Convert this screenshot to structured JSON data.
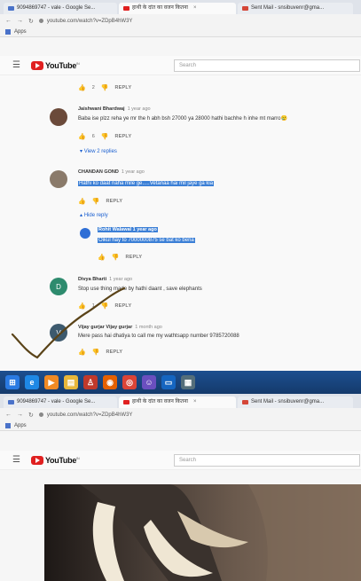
{
  "browser_top": {
    "tabs": [
      {
        "label": "9094869747 - vale - Google Se...",
        "favicon_color": "#4a72c9"
      },
      {
        "label": "हाथी के दांत का वजन कितना",
        "favicon_color": "#e02020"
      },
      {
        "label": "Sent Mail - snsibuvenr@gma...",
        "favicon_color": "#d44638"
      }
    ],
    "url": "youtube.com/watch?v=ZDpB4hW3Y",
    "bookmarks_label": "Apps"
  },
  "youtube_top": {
    "logo_text": "YouTube",
    "logo_sup": "IN",
    "search_placeholder": "Search"
  },
  "comments": [
    {
      "id": "c0",
      "likes": "2",
      "reply_label": "REPLY"
    },
    {
      "id": "c1",
      "author": "Jaishwani Bhardwaj",
      "time": "1 year ago",
      "text": "Baba ise plzz reha ye mr the h abh bsh 27000 ya 28000 hathi bachhe h inhe mt marro😢",
      "likes": "6",
      "reply_label": "REPLY",
      "view_replies": "View 2 replies"
    },
    {
      "id": "c2",
      "author": "CHANDAN GOND",
      "time": "1 year ago",
      "text": "Hathi ko daat naha mile ge.....Vetanaa hai mil jaye ga kia",
      "reply_label": "REPLY",
      "hide_reply": "Hide reply"
    },
    {
      "id": "c2r",
      "author": "Rohit Walawal",
      "time": "1 year ago",
      "text": "Oikul hay to 7000000875 se bat ko bena",
      "reply_label": "REPLY"
    },
    {
      "id": "c3",
      "author": "Divya Bharti",
      "time": "1 year ago",
      "avatar_letter": "D",
      "avatar_color": "#2e8b6e",
      "text": "Stop use thing made by hathi daant , save elephants",
      "likes": "1",
      "reply_label": "REPLY"
    },
    {
      "id": "c4",
      "author": "Vijay gurjar Vijay gurjar",
      "time": "1 month ago",
      "avatar_letter": "V",
      "avatar_color": "#3d5a6e",
      "text": "Mere pass hai dhatiya to call me my wathtsapp number 9785720088",
      "reply_label": "REPLY"
    }
  ],
  "taskbar": {
    "icons": [
      {
        "name": "windows-start-icon",
        "glyph": "⊞",
        "color": "#2a7ae2"
      },
      {
        "name": "internet-explorer-icon",
        "glyph": "e",
        "color": "#1e88e5"
      },
      {
        "name": "media-player-icon",
        "glyph": "▶",
        "color": "#f08a24"
      },
      {
        "name": "file-explorer-icon",
        "glyph": "▤",
        "color": "#e8b73a"
      },
      {
        "name": "security-app-icon",
        "glyph": "♙",
        "color": "#c0392b"
      },
      {
        "name": "firefox-icon",
        "glyph": "◉",
        "color": "#e66000"
      },
      {
        "name": "chrome-icon",
        "glyph": "◎",
        "color": "#db4437"
      },
      {
        "name": "people-app-icon",
        "glyph": "☺",
        "color": "#6a4fbf"
      },
      {
        "name": "remote-desktop-icon",
        "glyph": "▭",
        "color": "#1565c0"
      },
      {
        "name": "notes-app-icon",
        "glyph": "▦",
        "color": "#546e7a"
      }
    ]
  },
  "browser_bottom": {
    "tabs": [
      {
        "label": "9094869747 - vale - Google Se...",
        "favicon_color": "#4a72c9"
      },
      {
        "label": "हाथी के दांत का वजन कितना",
        "favicon_color": "#e02020"
      },
      {
        "label": "Sent Mail - snsibuvenr@gma...",
        "favicon_color": "#d44638"
      }
    ],
    "url": "youtube.com/watch?v=ZDpB4hW3Y",
    "bookmarks_label": "Apps"
  },
  "youtube_bottom": {
    "logo_text": "YouTube",
    "logo_sup": "IN",
    "search_placeholder": "Search"
  }
}
